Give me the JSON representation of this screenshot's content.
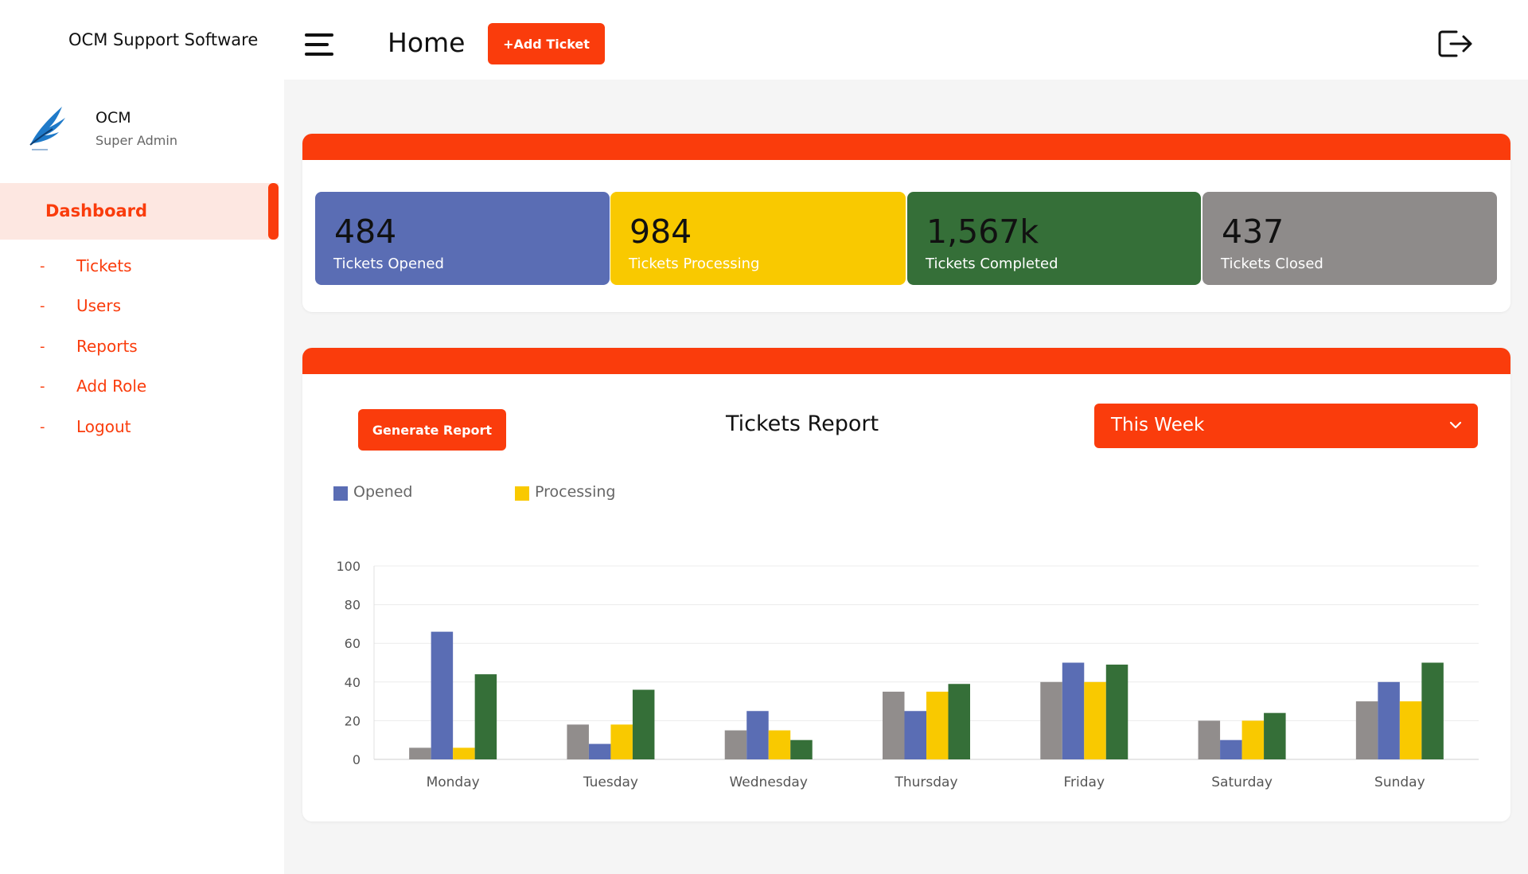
{
  "app": {
    "brand": "OCM Support Software"
  },
  "header": {
    "title": "Home",
    "add_ticket_label": "+Add Ticket"
  },
  "user": {
    "name": "OCM",
    "role": "Super Admin"
  },
  "sidebar": {
    "active": "Dashboard",
    "items": [
      {
        "dash": "-",
        "label": "Tickets"
      },
      {
        "dash": "-",
        "label": "Users"
      },
      {
        "dash": "-",
        "label": "Reports"
      },
      {
        "dash": "-",
        "label": "Add Role"
      },
      {
        "dash": "-",
        "label": "Logout"
      }
    ]
  },
  "stats": [
    {
      "value": "484",
      "label": "Tickets Opened",
      "color": "#5a6db4",
      "value_color": "#111111"
    },
    {
      "value": "984",
      "label": "Tickets Processing",
      "color": "#f9c900",
      "value_color": "#111111"
    },
    {
      "value": "1,567k",
      "label": "Tickets Completed",
      "color": "#356f38",
      "value_color": "#111111"
    },
    {
      "value": "437",
      "label": "Tickets Closed",
      "color": "#8e8b8a",
      "value_color": "#111111"
    }
  ],
  "report": {
    "generate_label": "Generate Report",
    "title": "Tickets Report",
    "period": "This Week"
  },
  "colors": {
    "accent": "#fa3c0c"
  },
  "chart_data": {
    "type": "bar",
    "categories": [
      "Monday",
      "Tuesday",
      "Wednesday",
      "Thursday",
      "Friday",
      "Saturday",
      "Sunday"
    ],
    "series": [
      {
        "color": "#918d8c",
        "values": [
          6,
          18,
          15,
          35,
          40,
          20,
          30
        ]
      },
      {
        "name": "Opened",
        "color": "#5a6db4",
        "values": [
          66,
          8,
          25,
          25,
          50,
          10,
          40
        ]
      },
      {
        "name": "Processing",
        "color": "#f9c900",
        "values": [
          6,
          18,
          15,
          35,
          40,
          20,
          30
        ]
      },
      {
        "color": "#356f38",
        "values": [
          44,
          36,
          10,
          39,
          49,
          24,
          50
        ]
      }
    ],
    "ylim": [
      0,
      100
    ],
    "yticks": [
      0,
      20,
      40,
      60,
      80,
      100
    ],
    "grid": true,
    "legend": "top-left"
  }
}
